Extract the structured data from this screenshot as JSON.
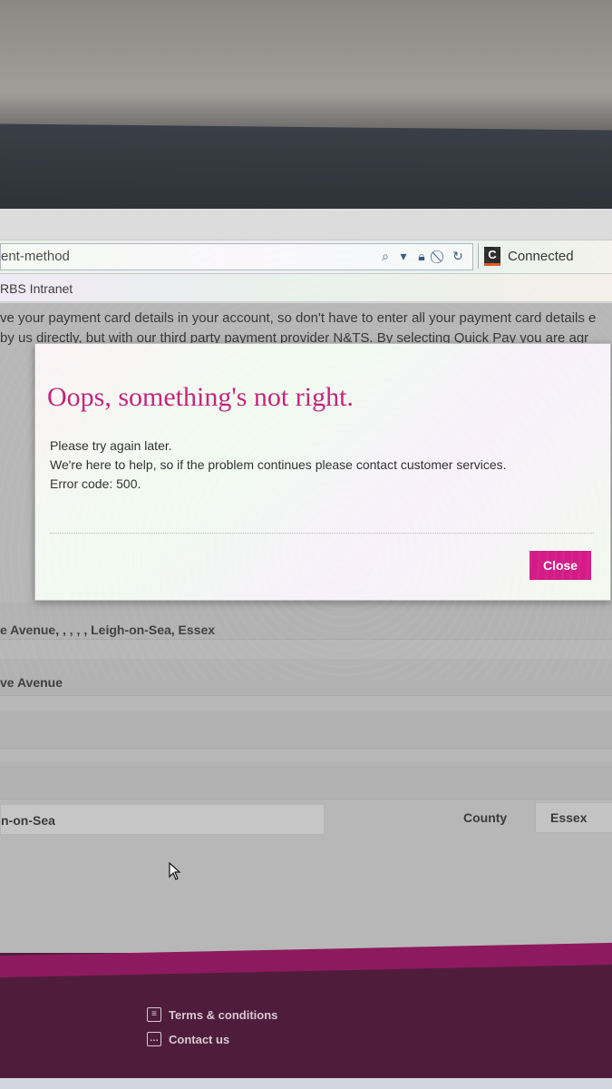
{
  "browser": {
    "url_fragment": "ent-method",
    "tab_title": "Connected",
    "tab_favicon_letter": "C",
    "favorite": "RBS Intranet"
  },
  "page": {
    "intro_line_1": "ve your payment card details in your account, so don't have to enter all your payment card details e",
    "intro_line_2": "by us directly, but with our third party payment provider N&TS. By selecting Quick Pay you are agr",
    "address_full": "e Avenue, , , , , Leigh-on-Sea, Essex",
    "address_line": "ve Avenue",
    "town_value": "n-on-Sea",
    "county_label": "County",
    "county_value": "Essex"
  },
  "modal": {
    "title": "Oops, something's not right.",
    "line_1": "Please try again later.",
    "line_2": "We're here to help, so if the problem continues please contact customer services.",
    "line_3": "Error code: 500.",
    "close_label": "Close",
    "accent_color": "#d41b87"
  },
  "footer": {
    "terms_label": "Terms & conditions",
    "contact_label": "Contact us",
    "terms_icon": "document-icon",
    "contact_icon": "chat-icon"
  }
}
